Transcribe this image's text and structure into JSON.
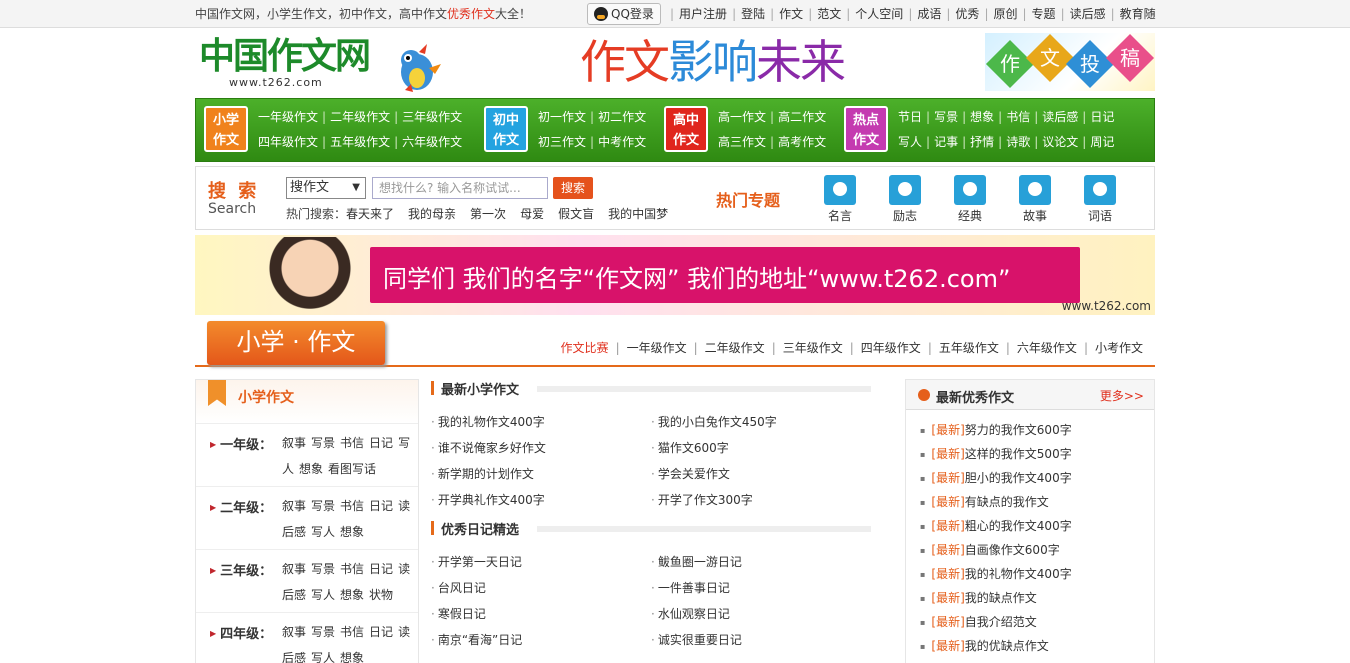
{
  "topbar": {
    "slogan_pre": "中国作文网，小学生作文，初中作文，高中作文",
    "slogan_hl": "优秀作文",
    "slogan_post": "大全！",
    "qq_login": "QQ登录",
    "links": [
      "用户注册",
      "登陆",
      "作文",
      "范文",
      "个人空间",
      "成语",
      "优秀",
      "原创",
      "专题",
      "读后感",
      "教育随"
    ]
  },
  "header": {
    "logo_text": "中国作文网",
    "logo_url": "www.t262.com",
    "slogan_chars": [
      "作文",
      "影响",
      "未来"
    ],
    "tougao_chars": [
      "作",
      "文",
      "投",
      "稿"
    ],
    "tougao_colors": [
      "#4cb84a",
      "#e8a71a",
      "#2e8fd6",
      "#e94f8a"
    ]
  },
  "nav": {
    "groups": [
      {
        "badge": "小学\n作文",
        "color": "#f0821c",
        "row1": [
          "一年级作文",
          "二年级作文",
          "三年级作文"
        ],
        "row2": [
          "四年级作文",
          "五年级作文",
          "六年级作文"
        ]
      },
      {
        "badge": "初中\n作文",
        "color": "#24a3e0",
        "row1": [
          "初一作文",
          "初二作文"
        ],
        "row2": [
          "初三作文",
          "中考作文"
        ]
      },
      {
        "badge": "高中\n作文",
        "color": "#e0261d",
        "row1": [
          "高一作文",
          "高二作文"
        ],
        "row2": [
          "高三作文",
          "高考作文"
        ]
      },
      {
        "badge": "热点\n作文",
        "color": "#c43bb0",
        "row1": [
          "节日",
          "写景",
          "想象",
          "书信",
          "读后感",
          "日记"
        ],
        "row2": [
          "写人",
          "记事",
          "抒情",
          "诗歌",
          "议论文",
          "周记"
        ]
      }
    ]
  },
  "search": {
    "label_cn": "搜 索",
    "label_en": "Search",
    "select_value": "搜作文",
    "input_placeholder": "想找什么? 输入名称试试...",
    "button": "搜索",
    "hot_label": "热门搜索：",
    "hot_items": [
      "春天来了",
      "我的母亲",
      "第一次",
      "母爱",
      "假文盲",
      "我的中国梦"
    ],
    "topic_title": "热门专题",
    "topics": [
      "名言",
      "励志",
      "经典",
      "故事",
      "词语"
    ]
  },
  "ad": {
    "text": "同学们 我们的名字“作文网”   我们的地址“www.t262.com”",
    "url": "www.t262.com"
  },
  "section": {
    "tab": "小学 · 作文",
    "links": [
      "作文比赛",
      "一年级作文",
      "二年级作文",
      "三年级作文",
      "四年级作文",
      "五年级作文",
      "六年级作文",
      "小考作文"
    ]
  },
  "left": {
    "title": "小学作文",
    "grades": [
      {
        "label": "一年级：",
        "items": [
          "叙事",
          "写景",
          "书信",
          "日记",
          "写人",
          "想象",
          "看图写话"
        ]
      },
      {
        "label": "二年级：",
        "items": [
          "叙事",
          "写景",
          "书信",
          "日记",
          "读后感",
          "写人",
          "想象"
        ]
      },
      {
        "label": "三年级：",
        "items": [
          "叙事",
          "写景",
          "书信",
          "日记",
          "读后感",
          "写人",
          "想象",
          "状物"
        ]
      },
      {
        "label": "四年级：",
        "items": [
          "叙事",
          "写景",
          "书信",
          "日记",
          "读后感",
          "写人",
          "想象"
        ]
      }
    ]
  },
  "middle": {
    "sections": [
      {
        "title": "最新小学作文",
        "items": [
          "我的礼物作文400字",
          "我的小白兔作文450字",
          "谁不说俺家乡好作文",
          "猫作文600字",
          "新学期的计划作文",
          "学会关爱作文",
          "开学典礼作文400字",
          "开学了作文300字"
        ]
      },
      {
        "title": "优秀日记精选",
        "items": [
          "开学第一天日记",
          "鲅鱼圈一游日记",
          "台风日记",
          "一件善事日记",
          "寒假日记",
          "水仙观察日记",
          "南京“看海”日记",
          "诚实很重要日记"
        ]
      }
    ]
  },
  "right": {
    "title": "最新优秀作文",
    "more": "更多>>",
    "tag": "[最新]",
    "items": [
      "努力的我作文600字",
      "这样的我作文500字",
      "胆小的我作文400字",
      "有缺点的我作文",
      "粗心的我作文400字",
      "自画像作文600字",
      "我的礼物作文400字",
      "我的缺点作文",
      "自我介绍范文",
      "我的优缺点作文"
    ]
  }
}
